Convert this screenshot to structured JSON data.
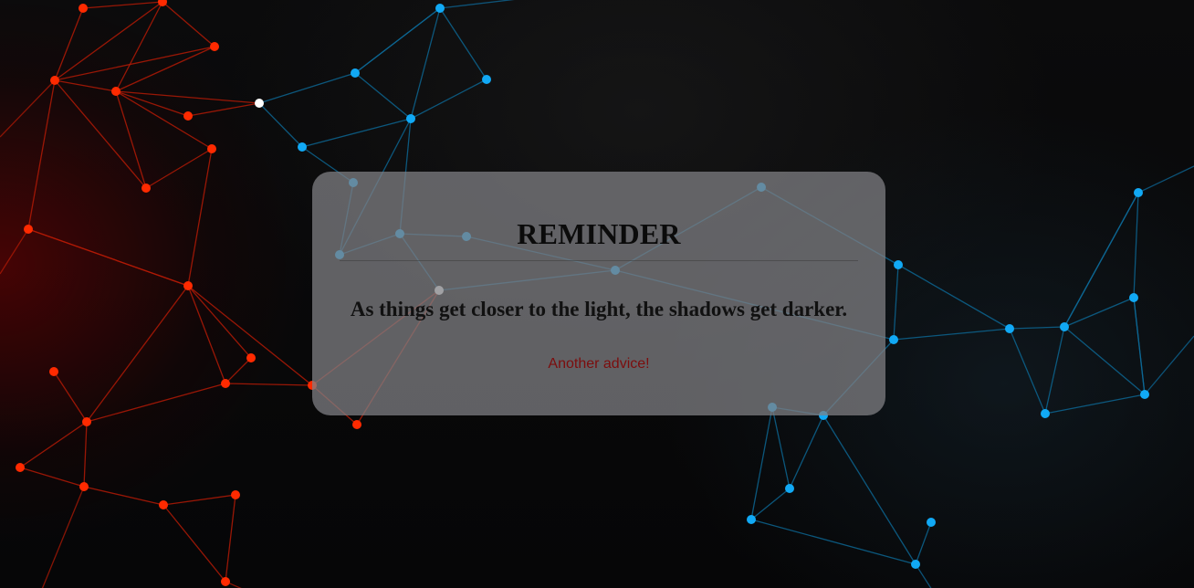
{
  "reminder_card": {
    "title": "REMINDER",
    "quote": "As things get closer to the light, the shadows get darker.",
    "advice_button_label": "Another advice!"
  },
  "colors": {
    "red_node": "#ff2a00",
    "red_link": "#b11a06",
    "blue_node": "#11a9f5",
    "blue_link": "#0d6a99",
    "white_node": "#ffffff",
    "card_background": "#808084",
    "button_text": "#7c0d0d"
  }
}
